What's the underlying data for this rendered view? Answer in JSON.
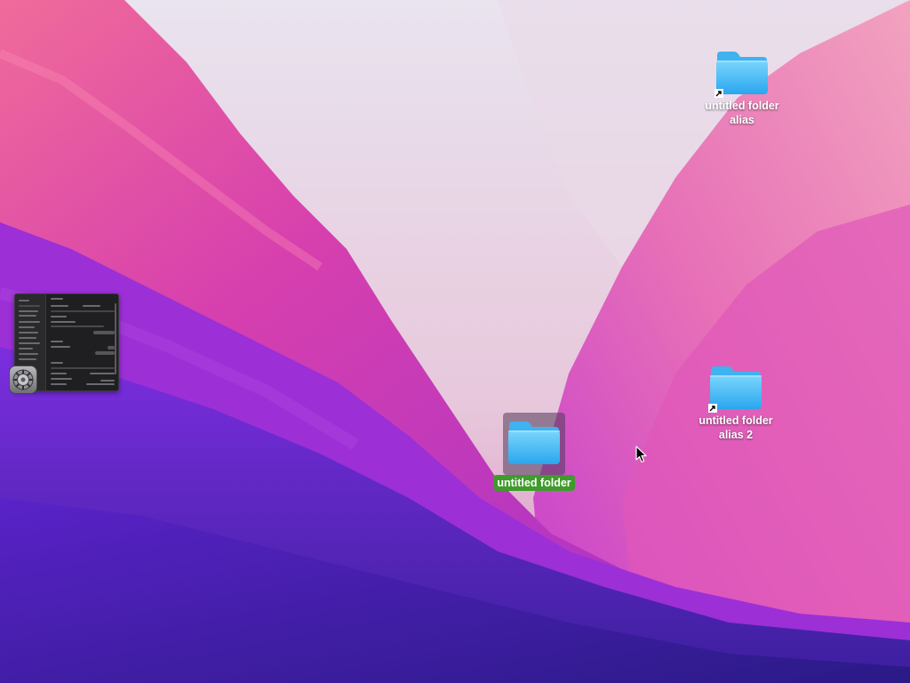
{
  "desktop": {
    "icons": [
      {
        "label_line1": "untitled folder",
        "label_line2": "alias",
        "type": "folder-alias"
      },
      {
        "label_line1": "untitled folder",
        "label_line2": "alias 2",
        "type": "folder-alias"
      },
      {
        "label": "untitled folder",
        "type": "folder",
        "selected": true
      }
    ],
    "window_thumbnail": {
      "app_icon": "system-preferences-gear-icon"
    }
  },
  "colors": {
    "folder_top": "#6fd0fb",
    "folder_bottom": "#2aa8ef",
    "selection_label": "#3f9b2b"
  }
}
